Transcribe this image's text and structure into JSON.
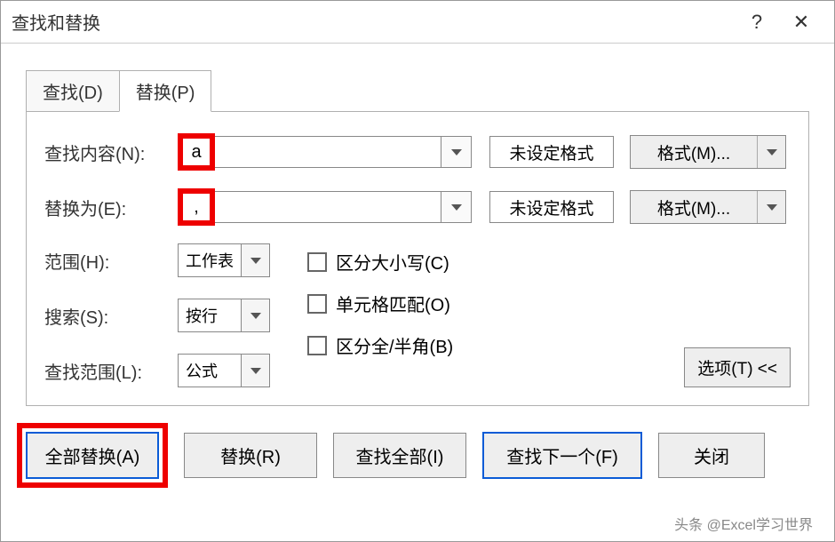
{
  "titlebar": {
    "title": "查找和替换",
    "help": "?",
    "close": "✕"
  },
  "tabs": {
    "find": "查找(D)",
    "replace": "替换(P)"
  },
  "fields": {
    "find_label": "查找内容(N):",
    "find_value": "a",
    "replace_label": "替换为(E):",
    "replace_value": ",",
    "format_unset": "未设定格式",
    "format_btn": "格式(M)..."
  },
  "options": {
    "scope_label": "范围(H):",
    "scope_value": "工作表",
    "search_label": "搜索(S):",
    "search_value": "按行",
    "lookin_label": "查找范围(L):",
    "lookin_value": "公式",
    "match_case": "区分大小写(C)",
    "match_cell": "单元格匹配(O)",
    "match_width": "区分全/半角(B)",
    "options_btn": "选项(T) <<"
  },
  "buttons": {
    "replace_all": "全部替换(A)",
    "replace": "替换(R)",
    "find_all": "查找全部(I)",
    "find_next": "查找下一个(F)",
    "close": "关闭"
  },
  "watermark": "头条 @Excel学习世界"
}
